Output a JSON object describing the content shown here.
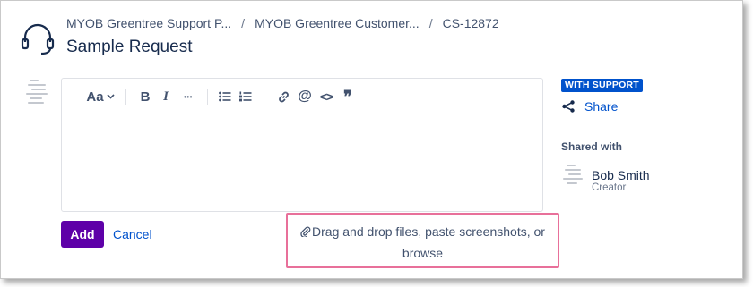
{
  "breadcrumb": {
    "items": [
      "MYOB Greentree Support P...",
      "MYOB Greentree Customer...",
      "CS-12872"
    ],
    "separator": "/"
  },
  "page_title": "Sample Request",
  "editor": {
    "toolbar": {
      "text_style": "Aa",
      "bold": "B",
      "italic": "I",
      "more": "•••",
      "mention": "@",
      "code": "<>",
      "quote": "❞"
    }
  },
  "actions": {
    "add_label": "Add",
    "cancel_label": "Cancel"
  },
  "dropzone": {
    "text": "Drag and drop files, paste screenshots, or",
    "browse_label": "browse"
  },
  "sidebar": {
    "badge": "WITH SUPPORT",
    "share_label": "Share",
    "shared_with_heading": "Shared with",
    "user": {
      "name": "Bob Smith",
      "role": "Creator"
    }
  },
  "colors": {
    "add_button": "#5e00a8",
    "link": "#0052cc",
    "badge": "#0052cc",
    "dropzone_highlight": "#e8709a"
  }
}
